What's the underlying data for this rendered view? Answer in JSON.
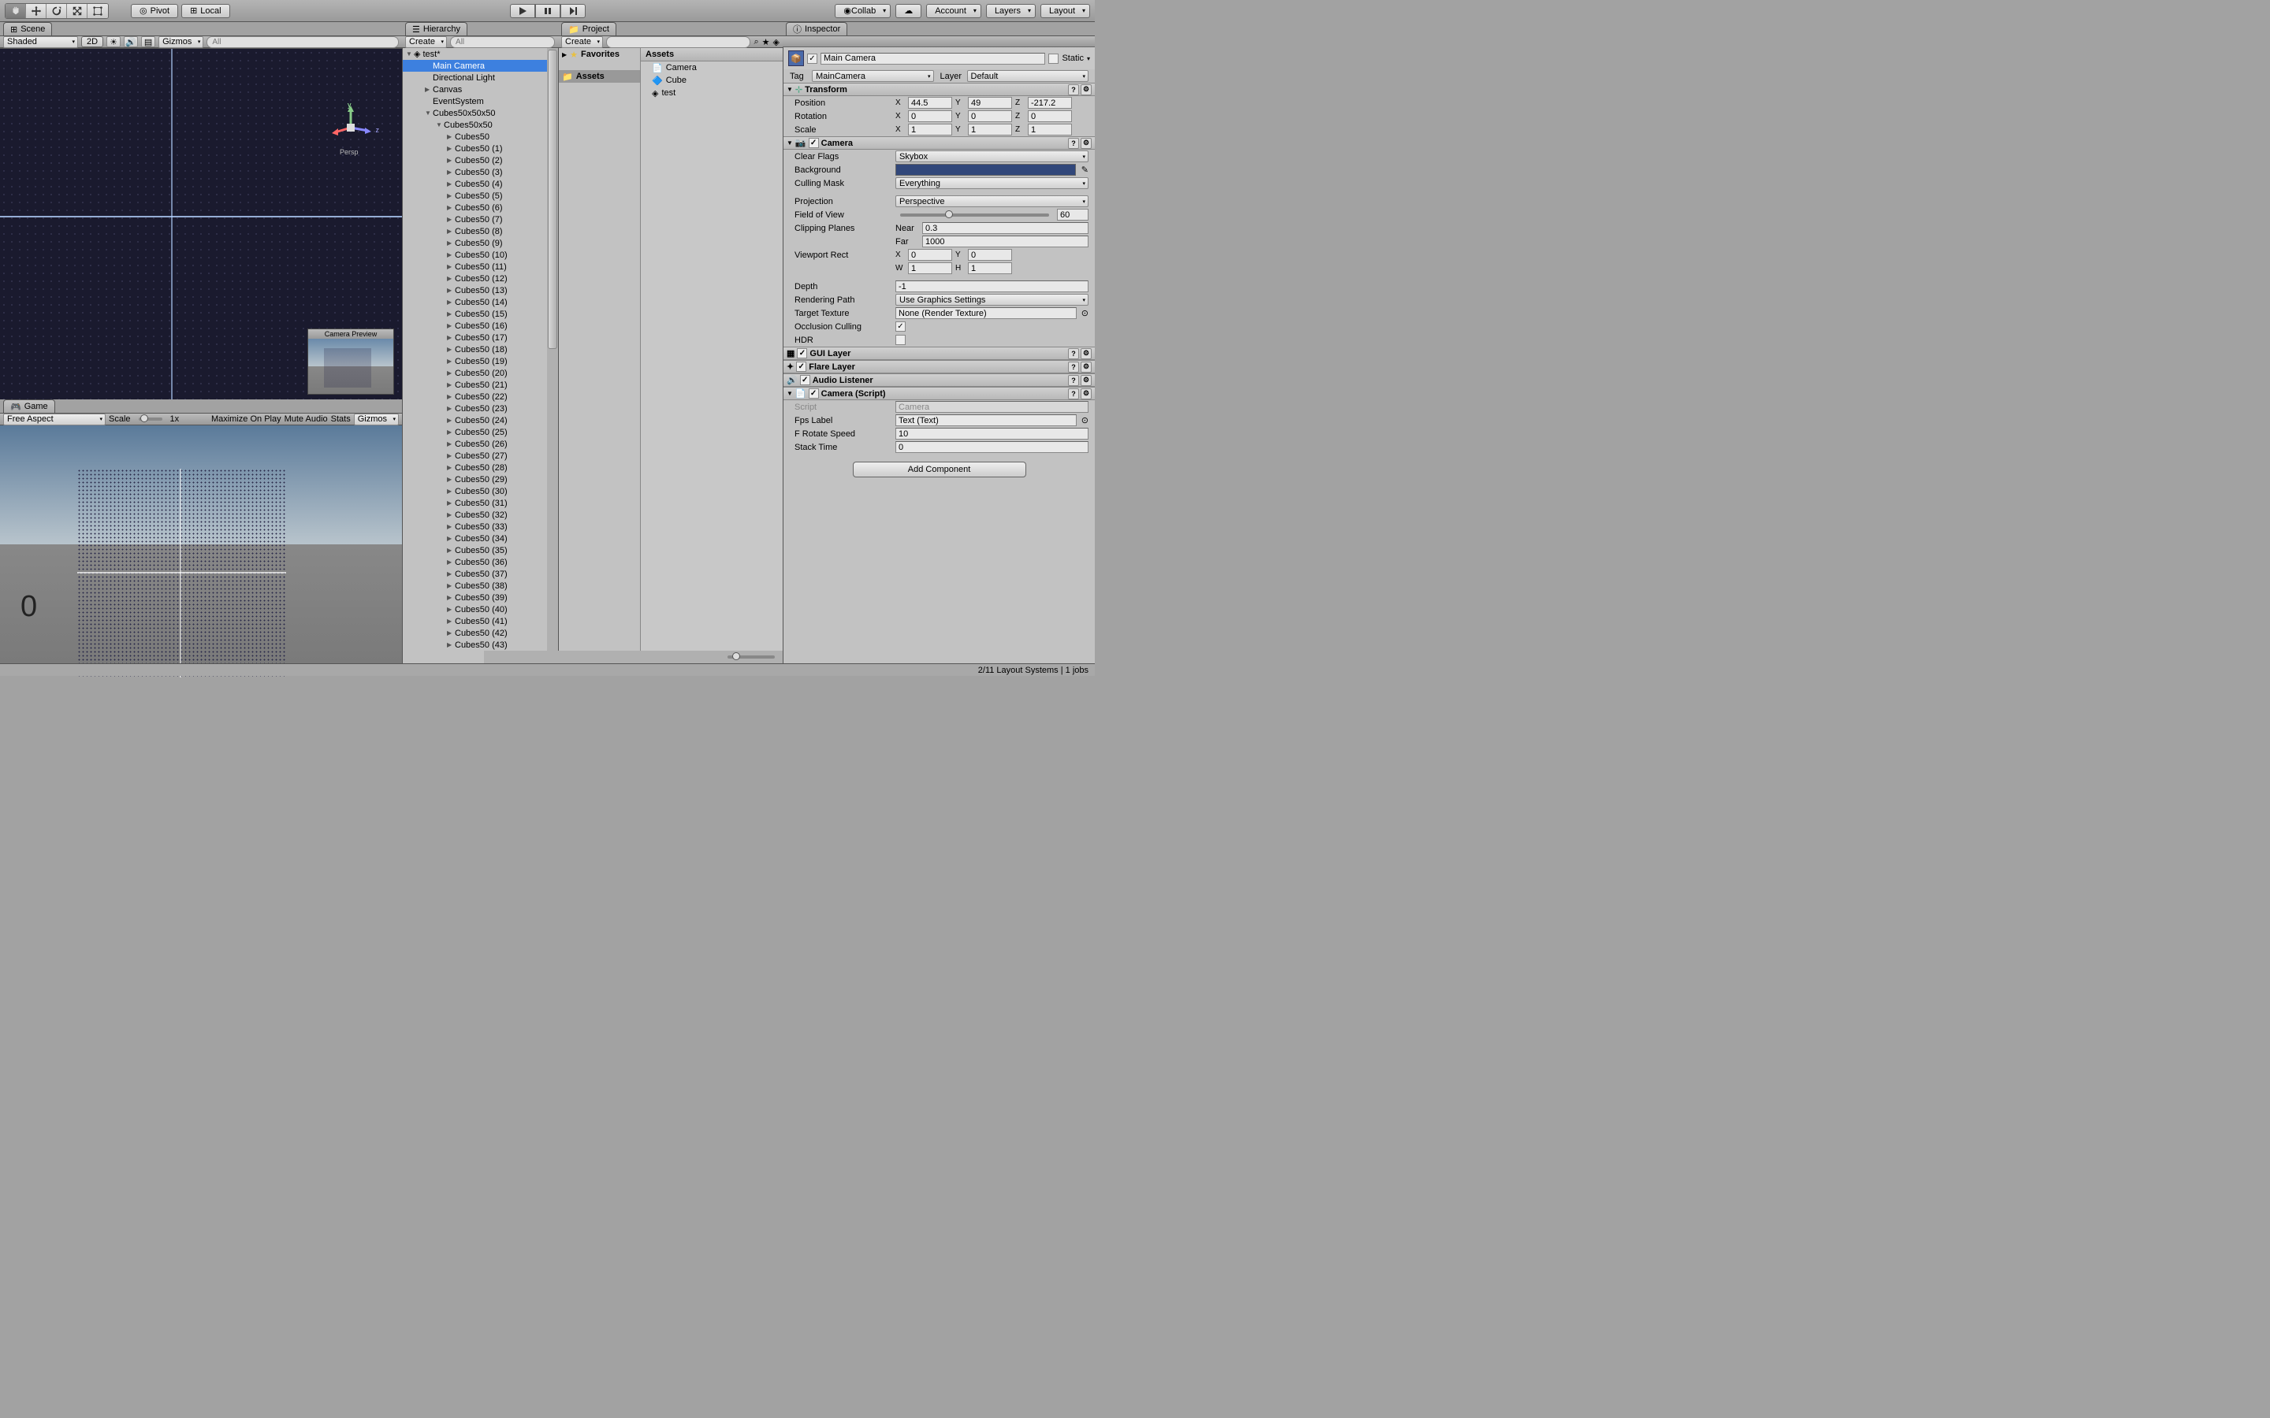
{
  "toolbar": {
    "pivot_label": "Pivot",
    "local_label": "Local",
    "collab_label": "Collab",
    "account_label": "Account",
    "layers_label": "Layers",
    "layout_label": "Layout"
  },
  "scene": {
    "tab_label": "Scene",
    "shading_mode": "Shaded",
    "twod_label": "2D",
    "gizmos_label": "Gizmos",
    "search_placeholder": "All",
    "persp_label": "Persp",
    "cam_preview_label": "Camera Preview",
    "axis_y": "y",
    "axis_z": "z"
  },
  "game": {
    "tab_label": "Game",
    "aspect": "Free Aspect",
    "scale_label": "Scale",
    "scale_value": "1x",
    "max_on_play": "Maximize On Play",
    "mute_audio": "Mute Audio",
    "stats": "Stats",
    "gizmos": "Gizmos",
    "fps_text": "0"
  },
  "hierarchy": {
    "tab_label": "Hierarchy",
    "create_label": "Create",
    "search_placeholder": "All",
    "scene_name": "test*",
    "items": [
      {
        "label": "Main Camera",
        "indent": 2,
        "selected": true
      },
      {
        "label": "Directional Light",
        "indent": 2
      },
      {
        "label": "Canvas",
        "indent": 2,
        "arrow": true
      },
      {
        "label": "EventSystem",
        "indent": 2
      },
      {
        "label": "Cubes50x50x50",
        "indent": 2,
        "arrow": true,
        "open": true
      },
      {
        "label": "Cubes50x50",
        "indent": 3,
        "arrow": true,
        "open": true
      },
      {
        "label": "Cubes50",
        "indent": 4,
        "arrow": true
      },
      {
        "label": "Cubes50 (1)",
        "indent": 4,
        "arrow": true
      },
      {
        "label": "Cubes50 (2)",
        "indent": 4,
        "arrow": true
      },
      {
        "label": "Cubes50 (3)",
        "indent": 4,
        "arrow": true
      },
      {
        "label": "Cubes50 (4)",
        "indent": 4,
        "arrow": true
      },
      {
        "label": "Cubes50 (5)",
        "indent": 4,
        "arrow": true
      },
      {
        "label": "Cubes50 (6)",
        "indent": 4,
        "arrow": true
      },
      {
        "label": "Cubes50 (7)",
        "indent": 4,
        "arrow": true
      },
      {
        "label": "Cubes50 (8)",
        "indent": 4,
        "arrow": true
      },
      {
        "label": "Cubes50 (9)",
        "indent": 4,
        "arrow": true
      },
      {
        "label": "Cubes50 (10)",
        "indent": 4,
        "arrow": true
      },
      {
        "label": "Cubes50 (11)",
        "indent": 4,
        "arrow": true
      },
      {
        "label": "Cubes50 (12)",
        "indent": 4,
        "arrow": true
      },
      {
        "label": "Cubes50 (13)",
        "indent": 4,
        "arrow": true
      },
      {
        "label": "Cubes50 (14)",
        "indent": 4,
        "arrow": true
      },
      {
        "label": "Cubes50 (15)",
        "indent": 4,
        "arrow": true
      },
      {
        "label": "Cubes50 (16)",
        "indent": 4,
        "arrow": true
      },
      {
        "label": "Cubes50 (17)",
        "indent": 4,
        "arrow": true
      },
      {
        "label": "Cubes50 (18)",
        "indent": 4,
        "arrow": true
      },
      {
        "label": "Cubes50 (19)",
        "indent": 4,
        "arrow": true
      },
      {
        "label": "Cubes50 (20)",
        "indent": 4,
        "arrow": true
      },
      {
        "label": "Cubes50 (21)",
        "indent": 4,
        "arrow": true
      },
      {
        "label": "Cubes50 (22)",
        "indent": 4,
        "arrow": true
      },
      {
        "label": "Cubes50 (23)",
        "indent": 4,
        "arrow": true
      },
      {
        "label": "Cubes50 (24)",
        "indent": 4,
        "arrow": true
      },
      {
        "label": "Cubes50 (25)",
        "indent": 4,
        "arrow": true
      },
      {
        "label": "Cubes50 (26)",
        "indent": 4,
        "arrow": true
      },
      {
        "label": "Cubes50 (27)",
        "indent": 4,
        "arrow": true
      },
      {
        "label": "Cubes50 (28)",
        "indent": 4,
        "arrow": true
      },
      {
        "label": "Cubes50 (29)",
        "indent": 4,
        "arrow": true
      },
      {
        "label": "Cubes50 (30)",
        "indent": 4,
        "arrow": true
      },
      {
        "label": "Cubes50 (31)",
        "indent": 4,
        "arrow": true
      },
      {
        "label": "Cubes50 (32)",
        "indent": 4,
        "arrow": true
      },
      {
        "label": "Cubes50 (33)",
        "indent": 4,
        "arrow": true
      },
      {
        "label": "Cubes50 (34)",
        "indent": 4,
        "arrow": true
      },
      {
        "label": "Cubes50 (35)",
        "indent": 4,
        "arrow": true
      },
      {
        "label": "Cubes50 (36)",
        "indent": 4,
        "arrow": true
      },
      {
        "label": "Cubes50 (37)",
        "indent": 4,
        "arrow": true
      },
      {
        "label": "Cubes50 (38)",
        "indent": 4,
        "arrow": true
      },
      {
        "label": "Cubes50 (39)",
        "indent": 4,
        "arrow": true
      },
      {
        "label": "Cubes50 (40)",
        "indent": 4,
        "arrow": true
      },
      {
        "label": "Cubes50 (41)",
        "indent": 4,
        "arrow": true
      },
      {
        "label": "Cubes50 (42)",
        "indent": 4,
        "arrow": true
      },
      {
        "label": "Cubes50 (43)",
        "indent": 4,
        "arrow": true
      }
    ]
  },
  "project": {
    "tab_label": "Project",
    "create_label": "Create",
    "tree": {
      "favorites": "Favorites",
      "assets": "Assets"
    },
    "breadcrumb": "Assets",
    "items": [
      {
        "label": "Camera",
        "icon": "script"
      },
      {
        "label": "Cube",
        "icon": "prefab"
      },
      {
        "label": "test",
        "icon": "scene"
      }
    ]
  },
  "inspector": {
    "tab_label": "Inspector",
    "object_name": "Main Camera",
    "static_label": "Static",
    "tag_label": "Tag",
    "tag_value": "MainCamera",
    "layer_label": "Layer",
    "layer_value": "Default",
    "transform": {
      "title": "Transform",
      "position_label": "Position",
      "position": {
        "x": "44.5",
        "y": "49",
        "z": "-217.2"
      },
      "rotation_label": "Rotation",
      "rotation": {
        "x": "0",
        "y": "0",
        "z": "0"
      },
      "scale_label": "Scale",
      "scale": {
        "x": "1",
        "y": "1",
        "z": "1"
      }
    },
    "camera": {
      "title": "Camera",
      "clear_flags_label": "Clear Flags",
      "clear_flags": "Skybox",
      "background_label": "Background",
      "background_color": "#31477a",
      "culling_mask_label": "Culling Mask",
      "culling_mask": "Everything",
      "projection_label": "Projection",
      "projection": "Perspective",
      "fov_label": "Field of View",
      "fov": "60",
      "clipping_label": "Clipping Planes",
      "near_label": "Near",
      "near": "0.3",
      "far_label": "Far",
      "far": "1000",
      "viewport_label": "Viewport Rect",
      "viewport": {
        "x": "0",
        "y": "0",
        "w": "1",
        "h": "1"
      },
      "depth_label": "Depth",
      "depth": "-1",
      "rendering_path_label": "Rendering Path",
      "rendering_path": "Use Graphics Settings",
      "target_texture_label": "Target Texture",
      "target_texture": "None (Render Texture)",
      "occlusion_label": "Occlusion Culling",
      "hdr_label": "HDR"
    },
    "gui_layer": "GUI Layer",
    "flare_layer": "Flare Layer",
    "audio_listener": "Audio Listener",
    "camera_script": {
      "title": "Camera (Script)",
      "script_label": "Script",
      "script_value": "Camera",
      "fps_label_label": "Fps Label",
      "fps_label_value": "Text (Text)",
      "f_rotate_label": "F Rotate Speed",
      "f_rotate_value": "10",
      "stack_time_label": "Stack Time",
      "stack_time_value": "0"
    },
    "add_component": "Add Component"
  },
  "status_bar": "2/11 Layout Systems | 1 jobs"
}
